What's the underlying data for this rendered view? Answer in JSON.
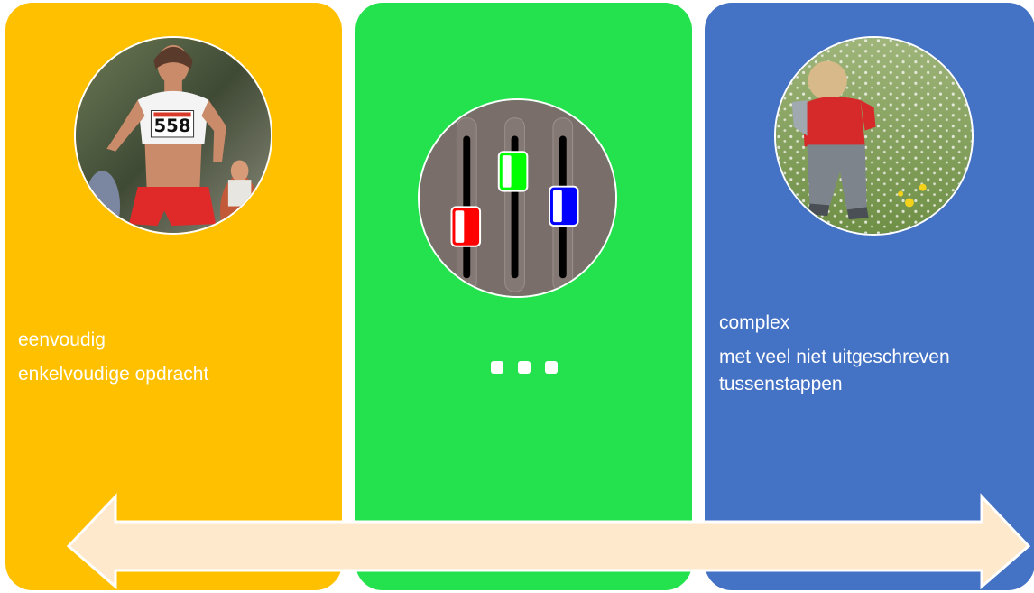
{
  "panels": {
    "left": {
      "color": "#FFC000",
      "title": "eenvoudig",
      "subtitle": "enkelvoudige opdracht",
      "image": "runner-photo"
    },
    "middle": {
      "color": "#23E24D",
      "image": "mixer-sliders-icon",
      "ellipsis": "…",
      "slider_colors": [
        "#FF0000",
        "#00FF00",
        "#0000FF"
      ]
    },
    "right": {
      "color": "#4472C4",
      "title": "complex",
      "subtitle_line1": "met veel niet uitgeschreven",
      "subtitle_line2": "tussenstappen",
      "image": "toddler-in-meadow-photo"
    }
  },
  "arrow": {
    "color": "#FFE9CC",
    "direction": "double-headed"
  }
}
